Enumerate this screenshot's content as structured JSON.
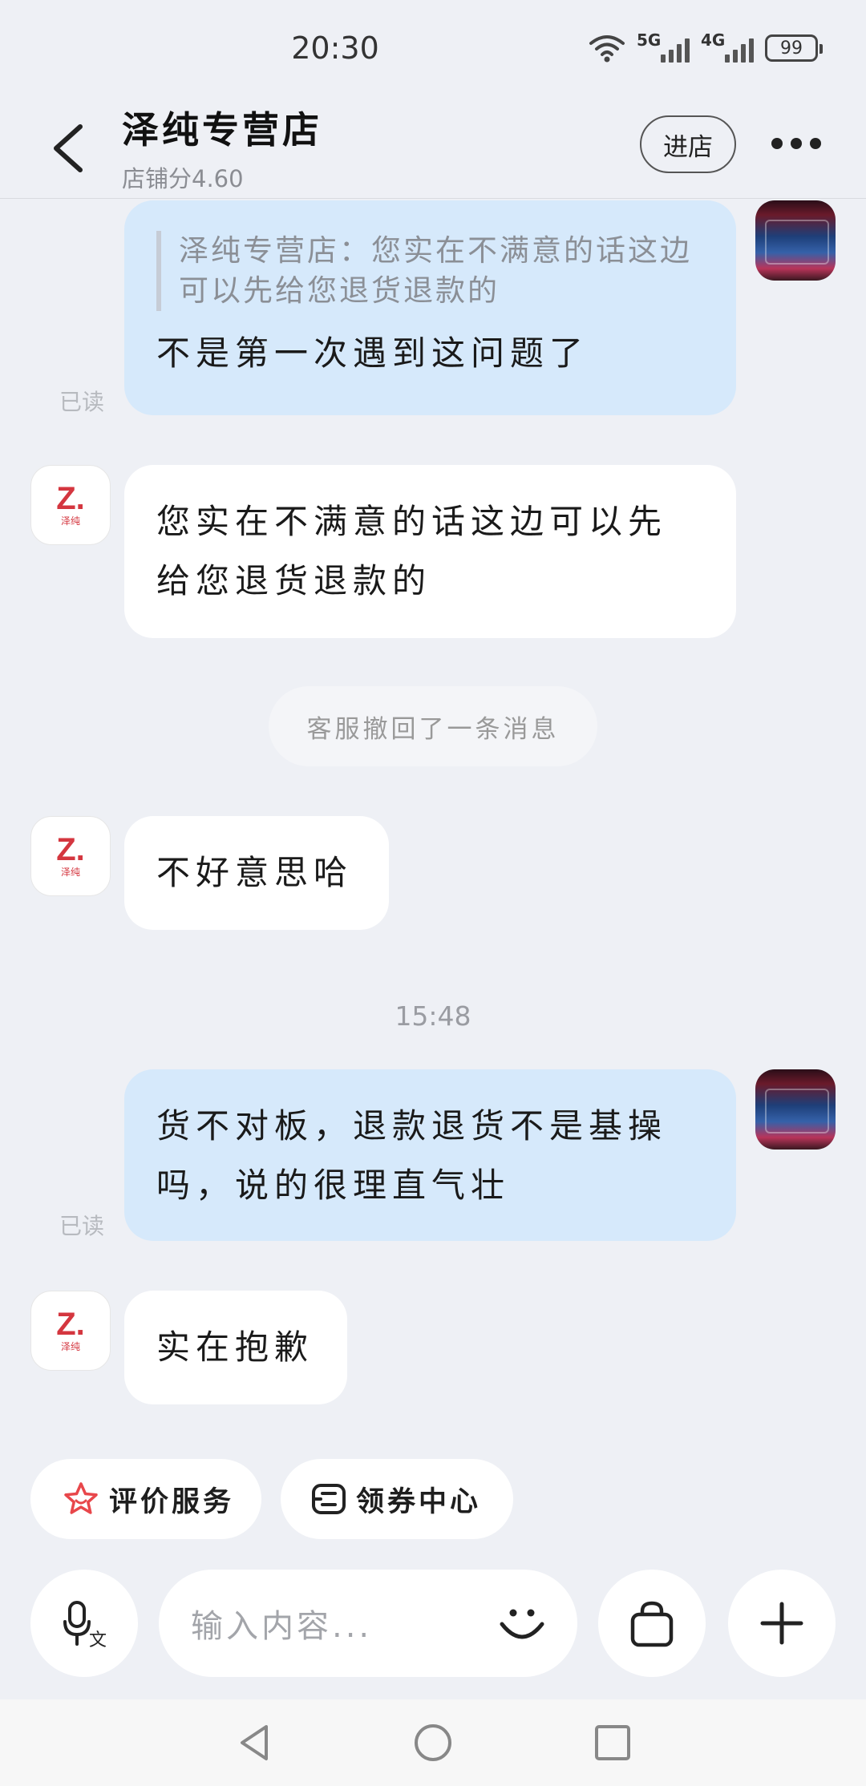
{
  "status_bar": {
    "time": "20:30",
    "network_1": "5G",
    "network_2": "4G",
    "battery": "99",
    "icons": [
      "wifi-icon",
      "signal-icon",
      "battery-icon"
    ]
  },
  "header": {
    "shop_name": "泽纯专营店",
    "shop_score": "店铺分4.60",
    "enter_label": "进店",
    "icons": [
      "back-icon",
      "more-icon"
    ]
  },
  "messages": {
    "m1": {
      "quote": "泽纯专营店：您实在不满意的话这边可以先给您退货退款的",
      "text": "不是第一次遇到这问题了",
      "read": "已读"
    },
    "m2": {
      "text": "您实在不满意的话这边可以先给您退货退款的"
    },
    "system": "客服撤回了一条消息",
    "m3": {
      "text": "不好意思哈"
    },
    "time_sep": "15:48",
    "m4": {
      "text": "货不对板，退款退货不是基操吗，说的很理直气壮",
      "read": "已读"
    },
    "m5": {
      "text": "实在抱歉"
    }
  },
  "shop_avatar": {
    "logo": "Z.",
    "sub": "泽纯"
  },
  "quick_actions": {
    "rate": "评价服务",
    "coupons": "领券中心"
  },
  "input_bar": {
    "placeholder": "输入内容...",
    "icons": [
      "voice-to-text-icon",
      "emoji-icon",
      "shopping-bag-icon",
      "plus-icon"
    ]
  },
  "nav_bar": {
    "icons": [
      "nav-back-icon",
      "nav-home-icon",
      "nav-recents-icon"
    ]
  },
  "colors": {
    "background": "#eef0f5",
    "outgoing_bubble": "#d6e9fb",
    "incoming_bubble": "#ffffff",
    "brand_red": "#d4363f"
  }
}
